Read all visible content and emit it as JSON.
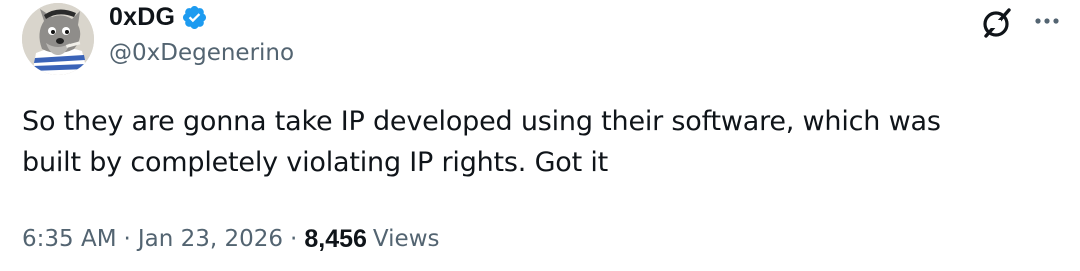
{
  "author": {
    "display_name": "0xDG",
    "handle": "@0xDegenerino",
    "verified": true,
    "avatar_icon": "cartoon-wolf-avatar",
    "verified_color": "#1d9bf0"
  },
  "actions": {
    "grok_icon": "grok-icon",
    "more_icon": "more-horizontal-icon"
  },
  "tweet": {
    "lines": [
      "So they are gonna take IP developed using their software, which was",
      "built by completely violating IP rights. Got it"
    ]
  },
  "meta": {
    "time": "6:35 AM",
    "separator": "·",
    "date": "Jan 23, 2026",
    "views_count": "8,456",
    "views_label": "Views"
  },
  "colors": {
    "text_primary": "#0f1419",
    "text_secondary": "#536471",
    "background": "#ffffff"
  }
}
